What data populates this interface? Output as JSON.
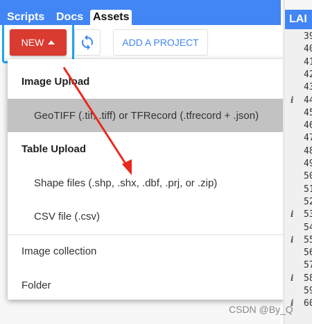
{
  "tabs": [
    {
      "label": "Scripts"
    },
    {
      "label": "Docs"
    },
    {
      "label": "Assets"
    }
  ],
  "toolbar": {
    "new_label": "NEW",
    "add_project_label": "ADD A PROJECT"
  },
  "menu": {
    "image_upload_header": "Image Upload",
    "geotiff_item": "GeoTIFF (.tif, .tiff) or TFRecord (.tfrecord + .json)",
    "table_upload_header": "Table Upload",
    "shape_item": "Shape files (.shp, .shx, .dbf, .prj, or .zip)",
    "csv_item": "CSV file (.csv)",
    "image_collection_item": "Image collection",
    "folder_item": "Folder"
  },
  "right_panel": {
    "title": "LAI",
    "line_numbers": [
      "39",
      "40",
      "41",
      "42",
      "43",
      "44",
      "45",
      "46",
      "47",
      "48",
      "49",
      "50",
      "51",
      "52",
      "53",
      "54",
      "55",
      "56",
      "57",
      "58",
      "59",
      "60"
    ],
    "info_marker": "i"
  },
  "watermark": "CSDN @By_Q",
  "colors": {
    "tab_bar": "#4285f4",
    "new_button": "#d93b31",
    "highlight_border": "#1ea3f0",
    "arrow": "#e8291c",
    "menu_hover": "#c2c2c2"
  }
}
